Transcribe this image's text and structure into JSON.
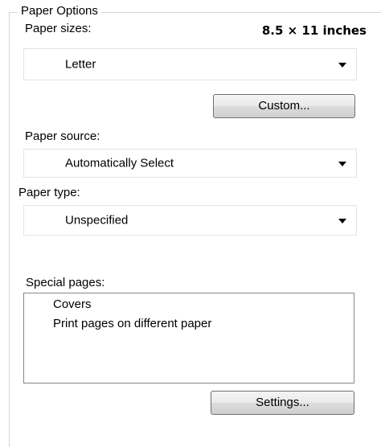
{
  "paper_options": {
    "legend": "Paper Options",
    "paper_sizes_label": "Paper sizes:",
    "size_readout": "8.5 × 11 inches",
    "paper_size_value": "Letter",
    "custom_button": "Custom...",
    "paper_source_label": "Paper source:",
    "paper_source_value": "Automatically Select",
    "paper_type_label": "Paper type:",
    "paper_type_value": "Unspecified",
    "special_pages_label": "Special pages:",
    "special_pages_items": [
      "Covers",
      "Print pages on different paper"
    ],
    "settings_button": "Settings..."
  }
}
